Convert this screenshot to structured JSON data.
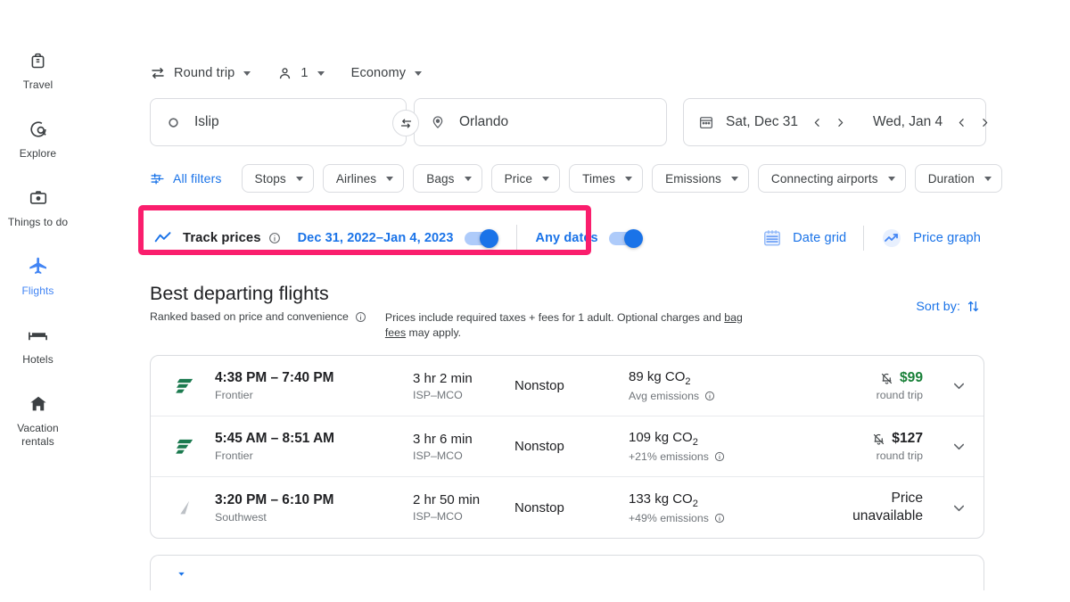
{
  "sidebar": {
    "items": [
      {
        "label": "Travel",
        "icon": "luggage-icon",
        "active": false
      },
      {
        "label": "Explore",
        "icon": "explore-icon",
        "active": false
      },
      {
        "label": "Things to do",
        "icon": "camera-icon",
        "active": false
      },
      {
        "label": "Flights",
        "icon": "airplane-icon",
        "active": true
      },
      {
        "label": "Hotels",
        "icon": "bed-icon",
        "active": false
      },
      {
        "label": "Vacation rentals",
        "icon": "house-icon",
        "active": false
      }
    ]
  },
  "trip_options": {
    "trip_type": "Round trip",
    "passengers": "1",
    "cabin_class": "Economy"
  },
  "search": {
    "origin": "Islip",
    "destination": "Orlando",
    "depart_date": "Sat, Dec 31",
    "return_date": "Wed, Jan 4"
  },
  "filters": {
    "all_filters_label": "All filters",
    "chips": [
      "Stops",
      "Airlines",
      "Bags",
      "Price",
      "Times",
      "Emissions",
      "Connecting airports",
      "Duration"
    ]
  },
  "track_prices": {
    "label": "Track prices",
    "date_range": "Dec 31, 2022–Jan 4, 2023",
    "date_range_toggle_on": true,
    "any_dates_label": "Any dates",
    "any_dates_toggle_on": true,
    "highlight_color": "#fa1e6d"
  },
  "view_tools": {
    "date_grid": "Date grid",
    "price_graph": "Price graph"
  },
  "results_header": {
    "title": "Best departing flights",
    "ranked_note": "Ranked based on price and convenience",
    "price_note_before": "Prices include required taxes + fees for 1 adult. Optional charges and ",
    "price_note_link": "bag fees",
    "price_note_after": " may apply.",
    "sort_by": "Sort by:"
  },
  "flights": [
    {
      "airline": "Frontier",
      "airline_logo": "frontier-logo",
      "times": "4:38 PM – 7:40 PM",
      "duration": "3 hr 2 min",
      "route": "ISP–MCO",
      "stops": "Nonstop",
      "emissions": "89 kg CO",
      "emissions_sub": "2",
      "emissions_note": "Avg emissions",
      "price": "$99",
      "price_style": "green",
      "price_sub": "round trip",
      "has_bell_icon": true
    },
    {
      "airline": "Frontier",
      "airline_logo": "frontier-logo",
      "times": "5:45 AM – 8:51 AM",
      "duration": "3 hr 6 min",
      "route": "ISP–MCO",
      "stops": "Nonstop",
      "emissions": "109 kg CO",
      "emissions_sub": "2",
      "emissions_note": "+21% emissions",
      "price": "$127",
      "price_style": "dark",
      "price_sub": "round trip",
      "has_bell_icon": true
    },
    {
      "airline": "Southwest",
      "airline_logo": "southwest-logo",
      "times": "3:20 PM – 6:10 PM",
      "duration": "2 hr 50 min",
      "route": "ISP–MCO",
      "stops": "Nonstop",
      "emissions": "133 kg CO",
      "emissions_sub": "2",
      "emissions_note": "+49% emissions",
      "price_unavailable_line1": "Price",
      "price_unavailable_line2": "unavailable",
      "price_style": "unavailable",
      "has_bell_icon": false
    }
  ]
}
